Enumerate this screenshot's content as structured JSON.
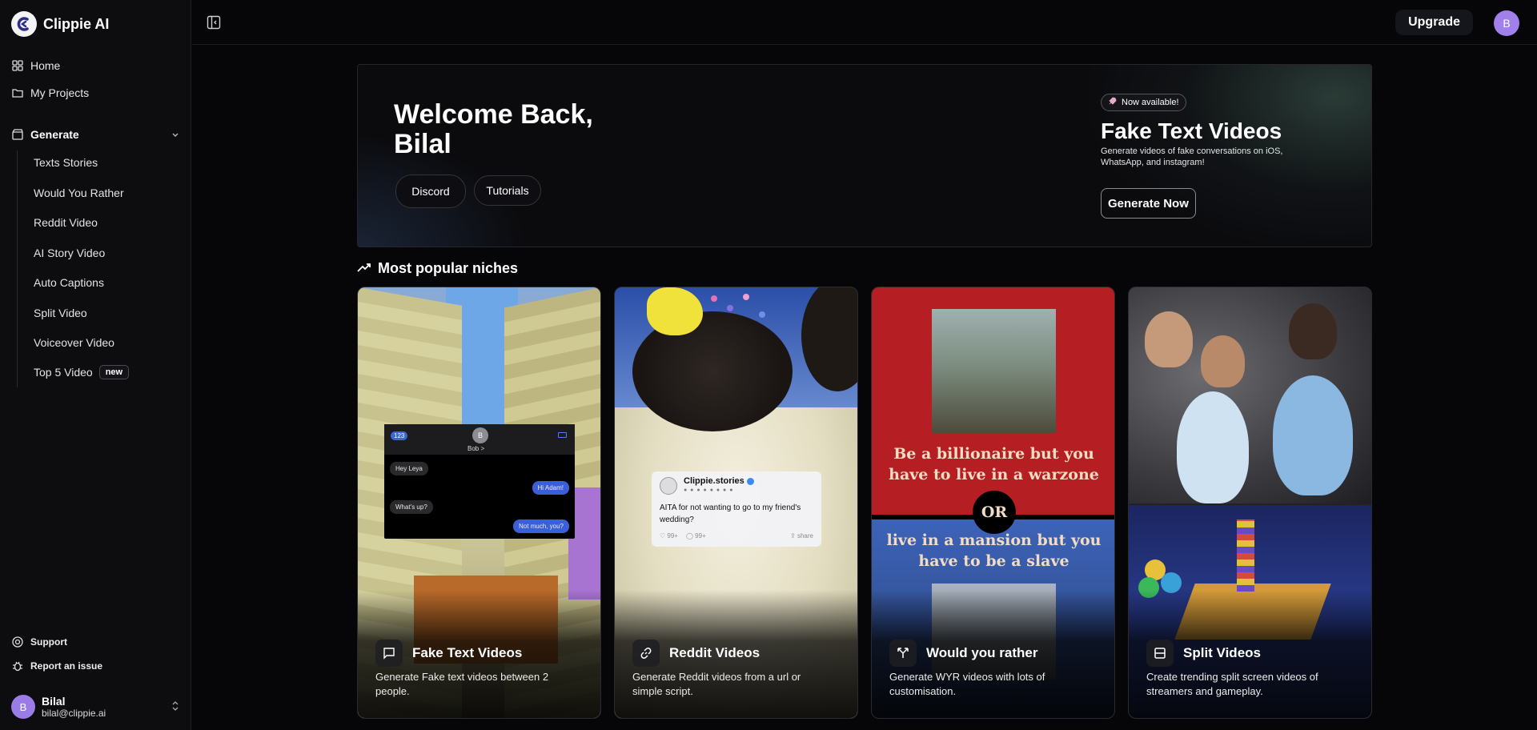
{
  "brand": {
    "name": "Clippie AI"
  },
  "sidebar": {
    "nav": [
      {
        "label": "Home",
        "icon": "grid-icon"
      },
      {
        "label": "My Projects",
        "icon": "folder-icon"
      }
    ],
    "generate": {
      "label": "Generate",
      "items": [
        {
          "label": "Texts Stories"
        },
        {
          "label": "Would You Rather"
        },
        {
          "label": "Reddit Video"
        },
        {
          "label": "AI Story Video"
        },
        {
          "label": "Auto Captions"
        },
        {
          "label": "Split Video"
        },
        {
          "label": "Voiceover Video"
        },
        {
          "label": "Top 5 Video",
          "badge": "new"
        }
      ]
    },
    "footer": [
      {
        "label": "Support",
        "icon": "lifebuoy-icon"
      },
      {
        "label": "Report an issue",
        "icon": "bug-icon"
      }
    ],
    "user": {
      "initial": "B",
      "name": "Bilal",
      "email": "bilal@clippie.ai"
    }
  },
  "topbar": {
    "upgrade_label": "Upgrade",
    "avatar_initial": "B"
  },
  "hero": {
    "title": "Welcome Back, Bilal",
    "discord_label": "Discord",
    "tutorials_label": "Tutorials",
    "badge": "Now available!",
    "promo_title": "Fake Text Videos",
    "promo_desc": "Generate videos of fake conversations on iOS, WhatsApp, and instagram!",
    "cta_label": "Generate Now"
  },
  "section": {
    "title": "Most popular niches"
  },
  "cards": [
    {
      "title": "Fake Text Videos",
      "desc": "Generate Fake text videos between 2 people.",
      "icon": "message-square-icon",
      "phone": {
        "back": "123",
        "avatar": "B",
        "name": "Bob >",
        "messages": [
          "Hey Leya",
          "Hi Adam!",
          "What's up?",
          "Not much, you?"
        ]
      }
    },
    {
      "title": "Reddit Videos",
      "desc": "Generate Reddit videos from a url or simple script.",
      "icon": "link-icon",
      "post": {
        "name": "Clippie.stories",
        "text": "AITA for not wanting to go to my friend's wedding?",
        "likes": "99+",
        "comments": "99+",
        "share": "share"
      }
    },
    {
      "title": "Would you rather",
      "desc": "Generate WYR videos with lots of customisation.",
      "icon": "split-arrows-icon",
      "option_a": "Be a billionaire but you have to live in a warzone",
      "or": "OR",
      "option_b": "live in a mansion but you have to be a slave"
    },
    {
      "title": "Split Videos",
      "desc": "Create trending split screen videos of streamers and gameplay.",
      "icon": "split-square-icon"
    }
  ],
  "colors": {
    "background": "#060608",
    "sidebar": "#0d0d10",
    "avatar": "#a280ec",
    "wyr_red": "#b51e22",
    "wyr_blue": "#3d63b8"
  }
}
